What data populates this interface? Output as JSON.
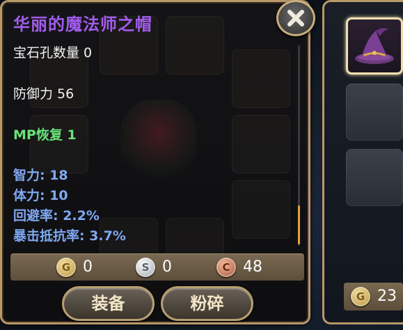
{
  "item_popup": {
    "title": "华丽的魔法师之帽",
    "title_color": "#a35cf0",
    "stats": [
      {
        "text": "宝石孔数量 0",
        "style": "normal"
      },
      {
        "text": "防御力 56",
        "style": "normal"
      },
      {
        "text": "MP恢复 1",
        "style": "green"
      },
      {
        "text": "智力: 18",
        "style": "blue"
      },
      {
        "text": "体力: 10",
        "style": "blue"
      },
      {
        "text": "回避率: 2.2%",
        "style": "blue"
      },
      {
        "text": "暴击抵抗率: 3.7%",
        "style": "blue"
      }
    ],
    "currency": {
      "gold": {
        "icon_letter": "G",
        "value": "0"
      },
      "silver": {
        "icon_letter": "S",
        "value": "0"
      },
      "copper": {
        "icon_letter": "C",
        "value": "48"
      }
    },
    "buttons": {
      "equip_label": "装备",
      "smash_label": "粉碎"
    },
    "close_icon": "close-icon"
  },
  "side_panel": {
    "slots": [
      {
        "content": "wizard-hat-icon",
        "selected": true
      },
      {
        "content": "empty",
        "selected": false
      },
      {
        "content": "empty",
        "selected": false
      }
    ],
    "gold": {
      "icon_letter": "G",
      "value": "23"
    }
  },
  "colors": {
    "frame_border": "#b89a6a",
    "stat_green": "#6ae27a",
    "stat_blue": "#7fa8f0",
    "button_text": "#f3e6c8"
  }
}
